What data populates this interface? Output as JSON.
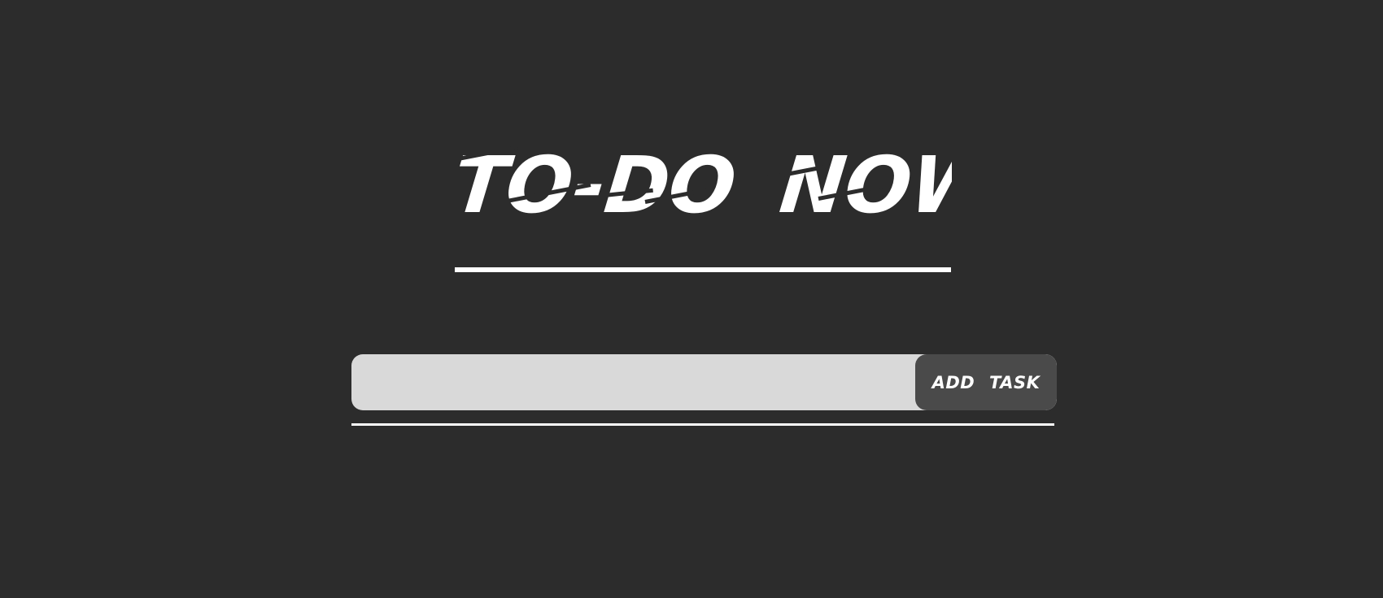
{
  "app": {
    "title": "TO-DO  NOW"
  },
  "task_form": {
    "input_value": "",
    "input_placeholder": "",
    "add_button_label": "ADD  TASK"
  },
  "colors": {
    "background": "#2c2c2c",
    "title": "#ffffff",
    "input_background": "#d9d9d9",
    "button_background": "#4a4a4a",
    "button_text": "#ffffff"
  }
}
